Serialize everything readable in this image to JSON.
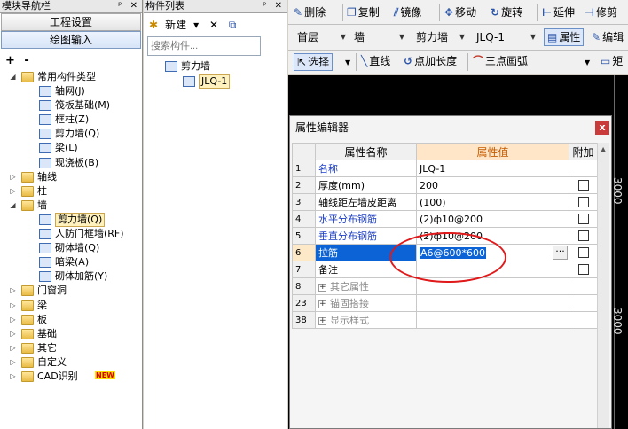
{
  "nav": {
    "title": "模块导航栏",
    "title_ctrls": "ᵖ ✕",
    "buttons": [
      "工程设置",
      "绘图输入"
    ],
    "tools": "+ -",
    "tree": [
      {
        "label": "常用构件类型",
        "level": 0,
        "expanded": true,
        "folder": true
      },
      {
        "label": "轴网(J)",
        "level": 1
      },
      {
        "label": "筏板基础(M)",
        "level": 1
      },
      {
        "label": "框柱(Z)",
        "level": 1
      },
      {
        "label": "剪力墙(Q)",
        "level": 1
      },
      {
        "label": "梁(L)",
        "level": 1
      },
      {
        "label": "现浇板(B)",
        "level": 1
      },
      {
        "label": "轴线",
        "level": 0,
        "folder": true
      },
      {
        "label": "柱",
        "level": 0,
        "folder": true
      },
      {
        "label": "墙",
        "level": 0,
        "expanded": true,
        "folder": true
      },
      {
        "label": "剪力墙(Q)",
        "level": 1,
        "selected": true
      },
      {
        "label": "人防门框墙(RF)",
        "level": 1
      },
      {
        "label": "砌体墙(Q)",
        "level": 1
      },
      {
        "label": "暗梁(A)",
        "level": 1
      },
      {
        "label": "砌体加筋(Y)",
        "level": 1
      },
      {
        "label": "门窗洞",
        "level": 0,
        "folder": true
      },
      {
        "label": "梁",
        "level": 0,
        "folder": true
      },
      {
        "label": "板",
        "level": 0,
        "folder": true
      },
      {
        "label": "基础",
        "level": 0,
        "folder": true
      },
      {
        "label": "其它",
        "level": 0,
        "folder": true
      },
      {
        "label": "自定义",
        "level": 0,
        "folder": true
      },
      {
        "label": "CAD识别",
        "level": 0,
        "folder": true,
        "badge": "NEW"
      }
    ]
  },
  "clist": {
    "title": "构件列表",
    "title_ctrls": "ᵖ ✕",
    "new_label": "新建",
    "delete_icon": "✕",
    "copy_icon": "⧉",
    "search_placeholder": "搜索构件...",
    "tree": [
      {
        "label": "剪力墙",
        "level": 0
      },
      {
        "label": "JLQ-1",
        "level": 1,
        "selected": true
      }
    ]
  },
  "toolbar1": {
    "items": [
      {
        "icon": "✎",
        "label": "删除"
      },
      {
        "icon": "❐",
        "label": "复制"
      },
      {
        "icon": "⫽",
        "label": "镜像"
      },
      {
        "icon": "✥",
        "label": "移动"
      },
      {
        "icon": "↻",
        "label": "旋转"
      },
      {
        "icon": "⊢",
        "label": "延伸"
      },
      {
        "icon": "⊣",
        "label": "修剪"
      }
    ]
  },
  "toolbar2": {
    "floor": "首层",
    "type": "墙",
    "sub_type": "剪力墙",
    "component": "JLQ-1",
    "property_btn": "属性",
    "edit_btn": "编辑"
  },
  "toolbar3": {
    "select": "选择",
    "line": "直线",
    "point_length": "点加长度",
    "arc": "三点画弧",
    "rect": "矩"
  },
  "canvas": {
    "dims": [
      "3000",
      "3000"
    ]
  },
  "dialog": {
    "title": "属性编辑器",
    "close": "x",
    "headers": [
      "",
      "属性名称",
      "属性值",
      "附加"
    ],
    "rows": [
      {
        "num": "1",
        "name": "名称",
        "value": "JLQ-1",
        "style": "blue",
        "checkbox": false
      },
      {
        "num": "2",
        "name": "厚度(mm)",
        "value": "200",
        "style": "",
        "checkbox": true
      },
      {
        "num": "3",
        "name": "轴线距左墙皮距离",
        "value": "(100)",
        "style": "",
        "checkbox": true
      },
      {
        "num": "4",
        "name": "水平分布钢筋",
        "value": "(2)ф10@200",
        "style": "blue",
        "checkbox": true
      },
      {
        "num": "5",
        "name": "垂直分布钢筋",
        "value": "(2)ф10@200",
        "style": "blue",
        "checkbox": true
      },
      {
        "num": "6",
        "name": "拉筋",
        "value": "A6@600*600",
        "style": "sel",
        "checkbox": true
      },
      {
        "num": "7",
        "name": "备注",
        "value": "",
        "style": "",
        "checkbox": true
      },
      {
        "num": "8",
        "name": "其它属性",
        "value": "",
        "style": "group",
        "checkbox": false
      },
      {
        "num": "23",
        "name": "锚固搭接",
        "value": "",
        "style": "group",
        "checkbox": false
      },
      {
        "num": "38",
        "name": "显示样式",
        "value": "",
        "style": "group",
        "checkbox": false
      }
    ],
    "ellipsis": "···"
  }
}
